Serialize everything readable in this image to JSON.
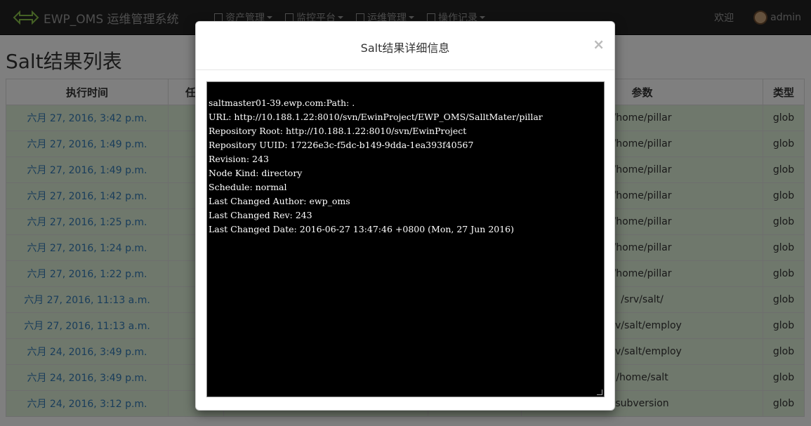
{
  "navbar": {
    "brand": "EWP_OMS 运维管理系统",
    "menu": [
      {
        "label": "资产管理"
      },
      {
        "label": "监控平台"
      },
      {
        "label": "运维管理"
      },
      {
        "label": "操作记录"
      }
    ],
    "welcome": "欢迎",
    "user": "admin"
  },
  "page": {
    "title": "Salt结果列表"
  },
  "table": {
    "headers": [
      "执行时间",
      "任务",
      "",
      "",
      "参数",
      "类型"
    ],
    "rows": [
      {
        "time": "六月 27, 2016, 3:42 p.m.",
        "param": "/home/pillar",
        "type": "glob"
      },
      {
        "time": "六月 27, 2016, 1:49 p.m.",
        "param": "/home/pillar",
        "type": "glob"
      },
      {
        "time": "六月 27, 2016, 1:49 p.m.",
        "param": "/home/pillar",
        "type": "glob"
      },
      {
        "time": "六月 27, 2016, 1:42 p.m.",
        "param": "/home/pillar",
        "type": "glob"
      },
      {
        "time": "六月 27, 2016, 1:25 p.m.",
        "param": "/home/pillar",
        "type": "glob"
      },
      {
        "time": "六月 27, 2016, 1:24 p.m.",
        "param": "/home/pillar",
        "type": "glob"
      },
      {
        "time": "六月 27, 2016, 1:22 p.m.",
        "param": "/home/pillar",
        "type": "glob"
      },
      {
        "time": "六月 27, 2016, 11:13 a.m.",
        "param": "/srv/salt/",
        "type": "glob"
      },
      {
        "time": "六月 27, 2016, 11:13 a.m.",
        "param": "/srv/salt/employ",
        "type": "glob"
      },
      {
        "time": "六月 24, 2016, 3:49 p.m.",
        "param": "/srv/salt/employ",
        "type": "glob"
      },
      {
        "time": "六月 24, 2016, 3:49 p.m.",
        "param": "/home/salt",
        "type": "glob"
      },
      {
        "time": "六月 24, 2016, 3:12 p.m.",
        "param": "subversion",
        "type": "glob"
      }
    ]
  },
  "modal": {
    "title": "Salt结果详细信息",
    "close": "×",
    "lines": [
      "saltmaster01-39.ewp.com:Path: .",
      "URL: http://10.188.1.22:8010/svn/EwinProject/EWP_OMS/SalltMater/pillar",
      "Repository Root: http://10.188.1.22:8010/svn/EwinProject",
      "Repository UUID: 17226e3c-f5dc-b149-9dda-1ea393f40567",
      "Revision: 243",
      "Node Kind: directory",
      "Schedule: normal",
      "Last Changed Author: ewp_oms",
      "Last Changed Rev: 243",
      "Last Changed Date: 2016-06-27 13:47:46 +0800 (Mon, 27 Jun 2016)"
    ]
  }
}
